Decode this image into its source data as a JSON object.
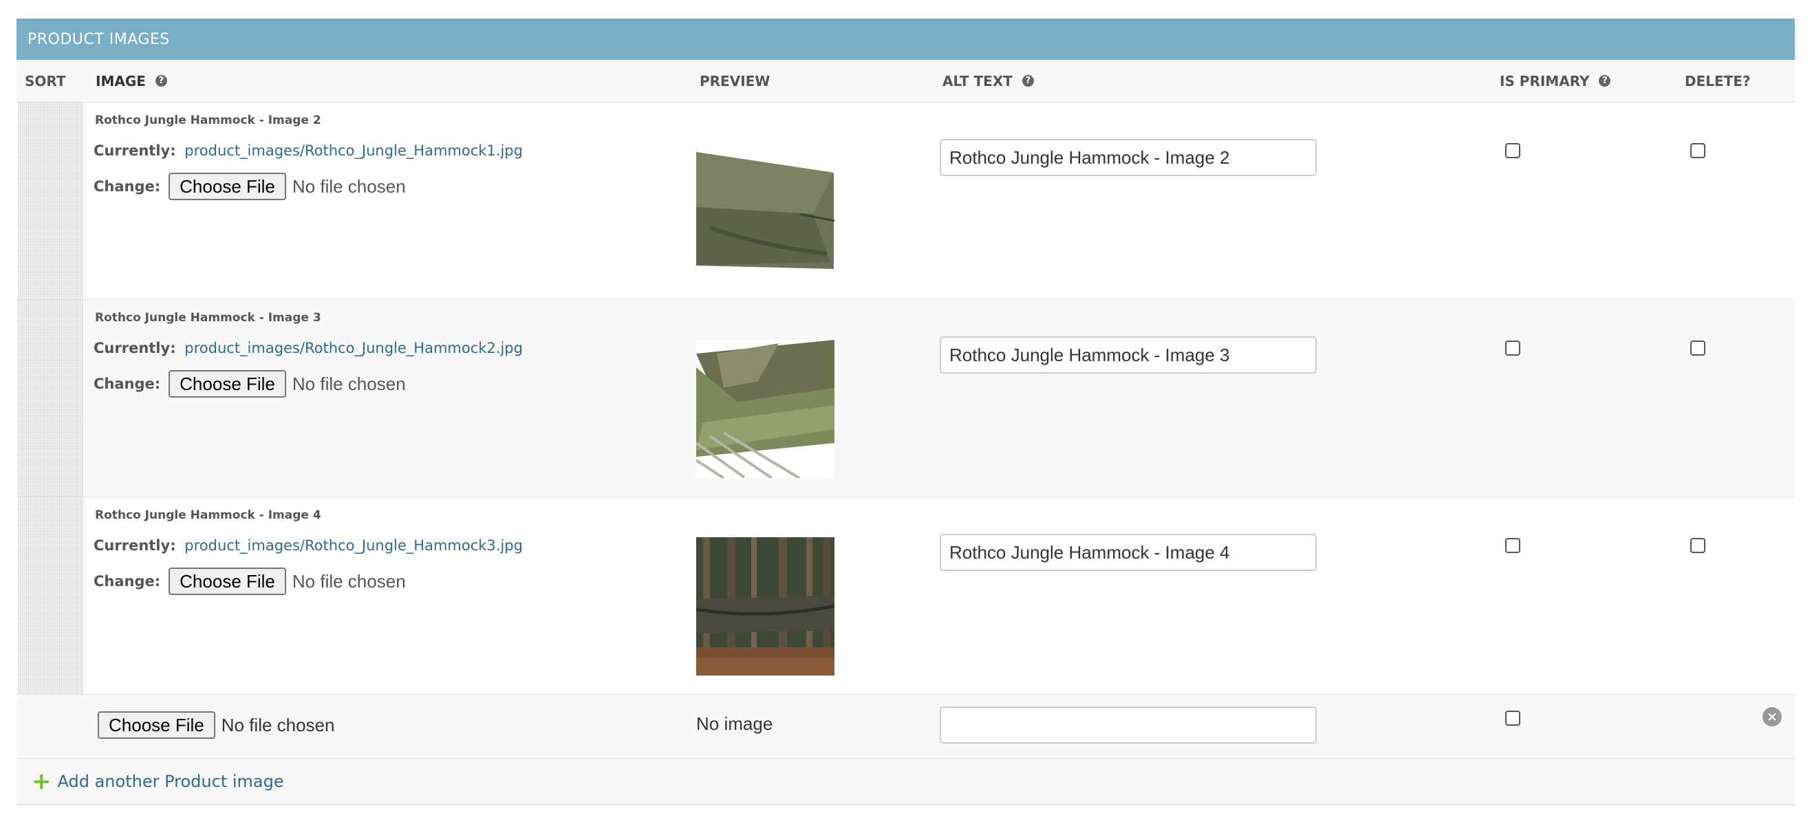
{
  "caption": "PRODUCT IMAGES",
  "headers": {
    "sort": "SORT",
    "image": "IMAGE",
    "preview": "PREVIEW",
    "alt_text": "ALT TEXT",
    "is_primary": "IS PRIMARY",
    "delete": "DELETE?"
  },
  "help_glyph": "?",
  "labels": {
    "currently": "Currently:",
    "change": "Change:",
    "choose_file": "Choose File",
    "no_file": "No file chosen",
    "no_image": "No image"
  },
  "rows": [
    {
      "original": "Rothco Jungle Hammock - Image 2",
      "current_file": "product_images/Rothco_Jungle_Hammock1.jpg",
      "alt_text": "Rothco Jungle Hammock - Image 2",
      "is_primary": false,
      "delete": false
    },
    {
      "original": "Rothco Jungle Hammock - Image 3",
      "current_file": "product_images/Rothco_Jungle_Hammock2.jpg",
      "alt_text": "Rothco Jungle Hammock - Image 3",
      "is_primary": false,
      "delete": false
    },
    {
      "original": "Rothco Jungle Hammock - Image 4",
      "current_file": "product_images/Rothco_Jungle_Hammock3.jpg",
      "alt_text": "Rothco Jungle Hammock - Image 4",
      "is_primary": false,
      "delete": false
    }
  ],
  "empty_form": {
    "alt_text": "",
    "is_primary": false
  },
  "add_another": "Add another Product image",
  "colors": {
    "caption_bg": "#79aec8",
    "link": "#2a6b8f",
    "add_icon": "#70bf2b"
  }
}
